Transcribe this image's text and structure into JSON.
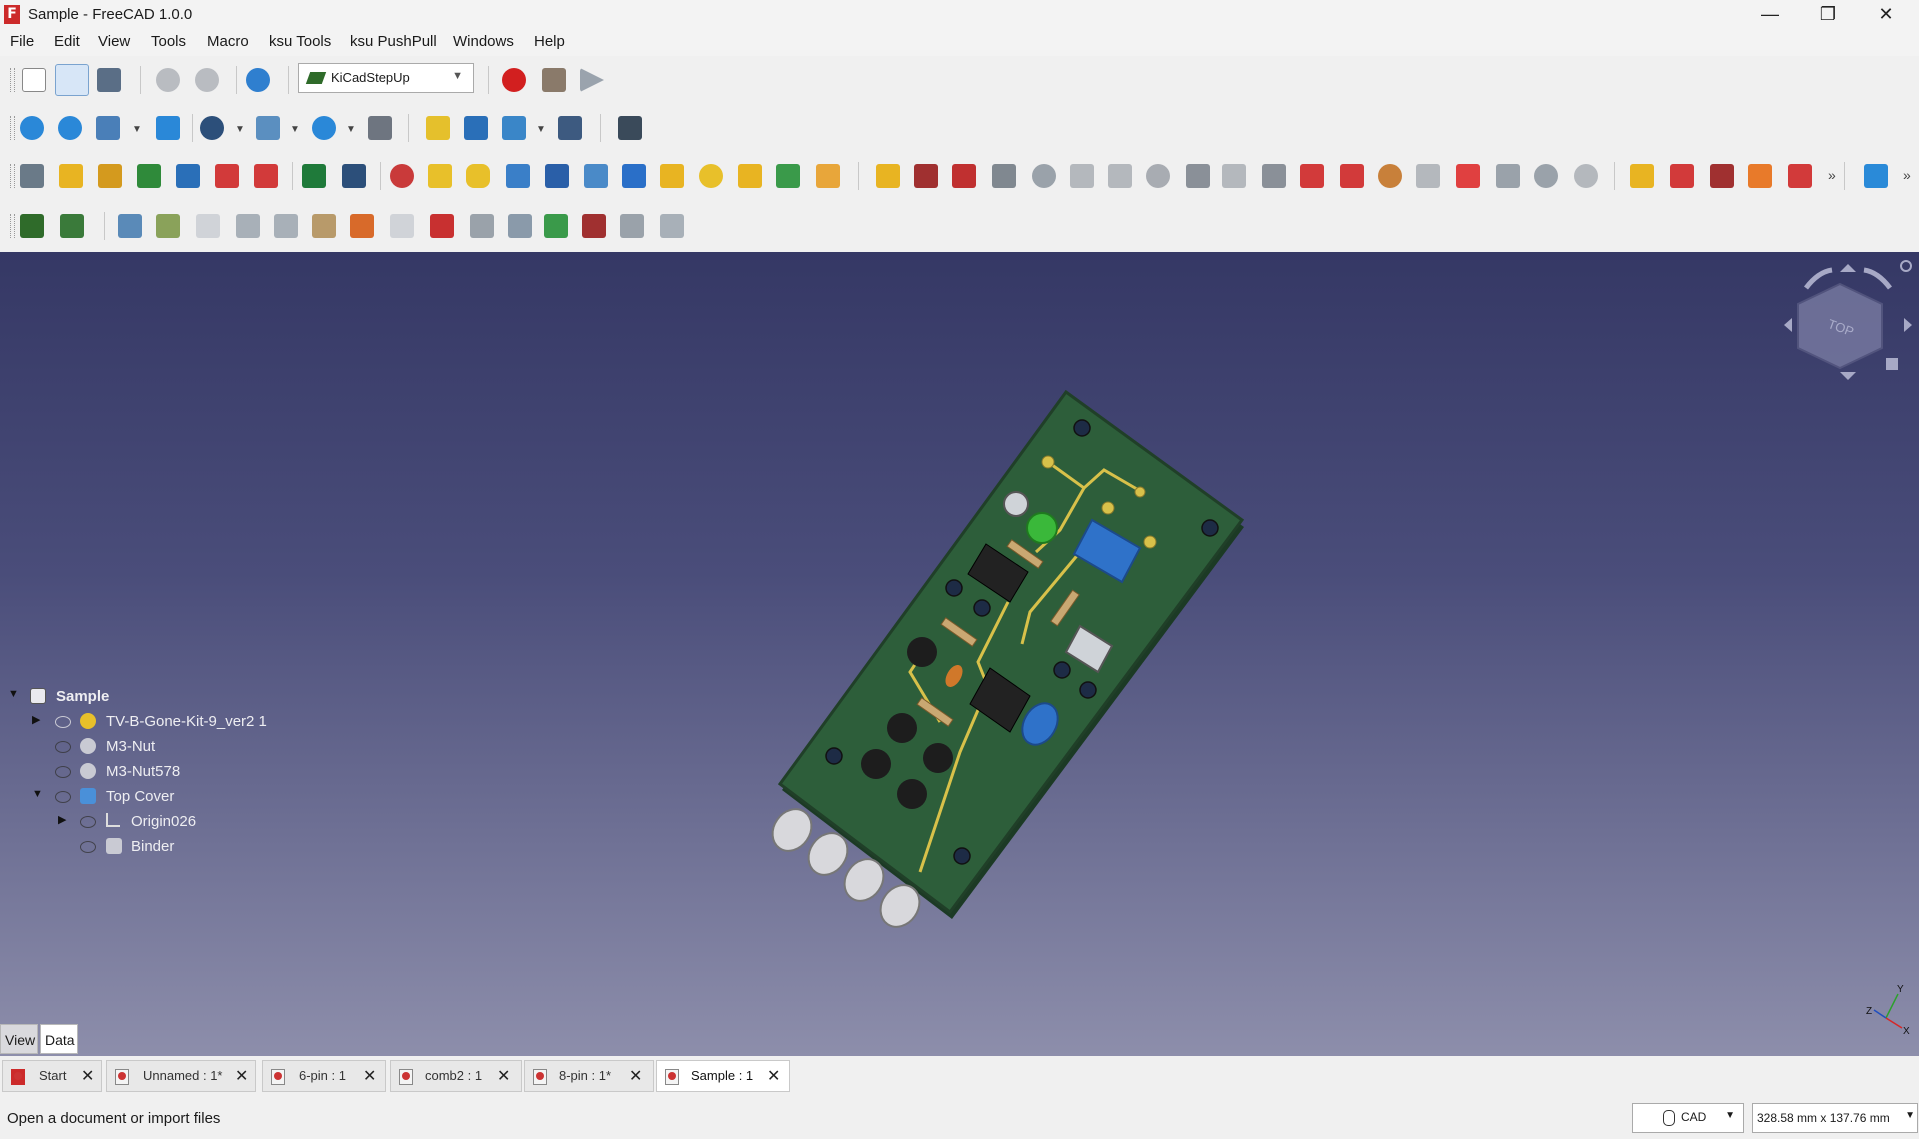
{
  "window": {
    "title": "Sample - FreeCAD 1.0.0",
    "logo": "F"
  },
  "window_controls": {
    "minimize": "—",
    "restore": "❐",
    "close": "✕"
  },
  "menu": [
    "File",
    "Edit",
    "View",
    "Tools",
    "Macro",
    "ksu Tools",
    "ksu PushPull",
    "Windows",
    "Help"
  ],
  "workbench": {
    "selected": "KiCadStepUp",
    "icon": "kicad-pcb-icon"
  },
  "tree": {
    "root": "Sample",
    "items": [
      "TV-B-Gone-Kit-9_ver2 1",
      "M3-Nut",
      "M3-Nut578",
      "Top Cover",
      "Origin026",
      "Binder"
    ]
  },
  "view_tabs": [
    "View",
    "Data"
  ],
  "doc_tabs": [
    "Start",
    "Unnamed : 1*",
    "6-pin : 1",
    "comb2 : 1",
    "8-pin : 1*",
    "Sample : 1"
  ],
  "status": {
    "message": "Open a document or import files",
    "nav_style": "CAD",
    "dimensions": "328.58 mm x 137.76 mm"
  },
  "navcube": {
    "face": "TOP"
  },
  "axes": {
    "x": "X",
    "y": "Y",
    "z": "Z"
  },
  "colors": {
    "pcb": "#2d5e3a",
    "trace": "#d8c14a",
    "led": "#3ab83a",
    "switch": "#2f72c9",
    "record": "#d21f1f"
  }
}
